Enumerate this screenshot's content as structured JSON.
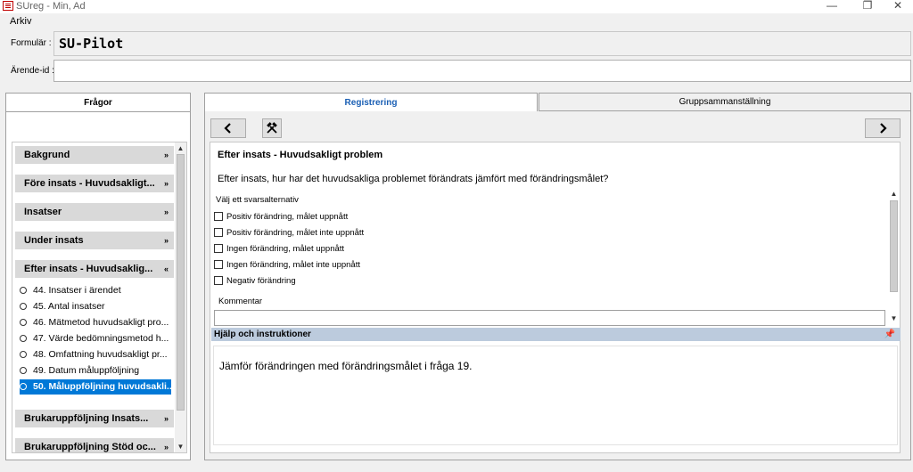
{
  "window": {
    "title": "SUreg - Min, Ad",
    "minimize": "—",
    "restore": "❐",
    "close": "✕"
  },
  "menu": {
    "arkiv": "Arkiv"
  },
  "form": {
    "formular_label": "Formulär :",
    "formular_value": "SU-Pilot",
    "arende_label": "Ärende-id :",
    "arende_value": ""
  },
  "left_panel": {
    "tab_label": "Frågor",
    "sections": [
      {
        "label": "Bakgrund",
        "chevron": "»"
      },
      {
        "label": "Före insats - Huvudsakligt...",
        "chevron": "»"
      },
      {
        "label": "Insatser",
        "chevron": "»"
      },
      {
        "label": "Under insats",
        "chevron": "»"
      },
      {
        "label": "Efter insats - Huvudsaklig...",
        "chevron": "«"
      }
    ],
    "items": [
      {
        "label": "44. Insatser i ärendet"
      },
      {
        "label": "45. Antal insatser"
      },
      {
        "label": "46. Mätmetod huvudsakligt pro..."
      },
      {
        "label": "47. Värde bedömningsmetod h..."
      },
      {
        "label": "48. Omfattning huvudsakligt pr..."
      },
      {
        "label": "49. Datum måluppföljning"
      },
      {
        "label": "50. Måluppföljning huvudsakli..."
      }
    ],
    "selected_item": "50. Måluppföljning huvudsakli...",
    "sections_after": [
      {
        "label": "Brukaruppföljning Insats...",
        "chevron": "»"
      },
      {
        "label": "Brukaruppföljning Stöd oc...",
        "chevron": "»"
      }
    ]
  },
  "tabs": {
    "registrering": "Registrering",
    "gruppsammanstallning": "Gruppsammanställning"
  },
  "question": {
    "title": "Efter insats - Huvudsakligt problem",
    "text": "Efter insats, hur har det huvudsakliga problemet förändrats jämfört med förändringsmålet?",
    "choose_label": "Välj ett svarsalternativ",
    "options": [
      {
        "label": "Positiv förändring, målet uppnått",
        "checked": false
      },
      {
        "label": "Positiv förändring, målet inte uppnått",
        "checked": false
      },
      {
        "label": "Ingen förändring, målet uppnått",
        "checked": false
      },
      {
        "label": "Ingen förändring, målet inte uppnått",
        "checked": false
      },
      {
        "label": "Negativ förändring",
        "checked": false
      }
    ],
    "comment_label": "Kommentar",
    "comment_value": ""
  },
  "help": {
    "header": "Hjälp och instruktioner",
    "text": "Jämför förändringen med förändringsmålet i fråga 19."
  },
  "icons": {
    "prev": "chevron-left-icon",
    "next": "chevron-right-icon",
    "tools": "tools-icon",
    "pin": "pin-icon"
  }
}
